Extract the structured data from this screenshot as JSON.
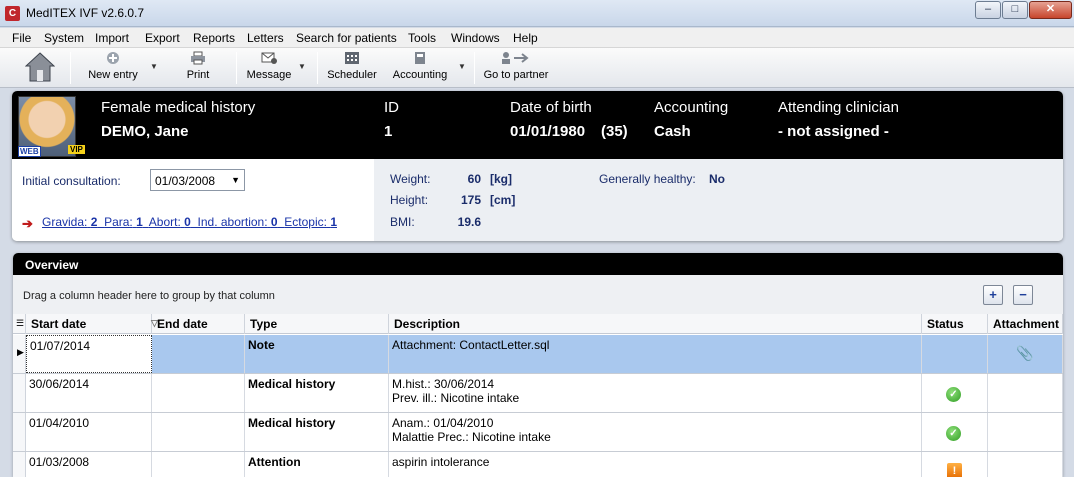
{
  "window": {
    "title": "MedITEX IVF v2.6.0.7",
    "icon": "C",
    "min": "‒",
    "max": "□",
    "close": "✕"
  },
  "menu": [
    "File",
    "System",
    "Import",
    "Export",
    "Reports",
    "Letters",
    "Search for patients",
    "Tools",
    "Windows",
    "Help"
  ],
  "toolbar": {
    "new_entry": "New entry",
    "print": "Print",
    "message": "Message",
    "scheduler": "Scheduler",
    "accounting": "Accounting",
    "go_to_partner": "Go to partner",
    "dropdown_glyph": "▼"
  },
  "patient": {
    "badge_web": "WEB",
    "badge_vip": "VIP",
    "history_label": "Female medical history",
    "name": "DEMO, Jane",
    "id_label": "ID",
    "id_value": "1",
    "dob_label": "Date of birth",
    "dob_value": "01/01/1980",
    "age": "(35)",
    "accounting_label": "Accounting",
    "accounting_value": "Cash",
    "clinician_label": "Attending clinician",
    "clinician_value": "- not assigned -",
    "initial_consultation_label": "Initial consultation:",
    "initial_consultation_value": "01/03/2008",
    "pregnancy": {
      "gravida_label": "Gravida:",
      "gravida": "2",
      "para_label": "Para:",
      "para": "1",
      "abort_label": "Abort:",
      "abort": "0",
      "ind_abortion_label": "Ind. abortion:",
      "ind_abortion": "0",
      "ectopic_label": "Ectopic:",
      "ectopic": "1"
    },
    "weight_label": "Weight:",
    "weight_value": "60",
    "weight_unit": "[kg]",
    "height_label": "Height:",
    "height_value": "175",
    "height_unit": "[cm]",
    "bmi_label": "BMI:",
    "bmi_value": "19.6",
    "healthy_label": "Generally healthy:",
    "healthy_value": "No"
  },
  "overview": {
    "title": "Overview",
    "group_hint": "Drag a column header here to group by that column",
    "expand_glyph": "+",
    "collapse_glyph": "−",
    "columns": [
      "Start date",
      "End date",
      "Type",
      "Description",
      "Status",
      "Attachment"
    ],
    "rows": [
      {
        "start": "01/07/2014",
        "end": "",
        "type": "Note",
        "desc1": "Attachment: ContactLetter.sql",
        "desc2": "",
        "status": "",
        "attachment": "paperclip-icon"
      },
      {
        "start": "30/06/2014",
        "end": "",
        "type": "Medical history",
        "desc1": "M.hist.: 30/06/2014",
        "desc2": "Prev. ill.: Nicotine intake",
        "status": "ok-icon",
        "attachment": ""
      },
      {
        "start": "01/04/2010",
        "end": "",
        "type": "Medical history",
        "desc1": "Anam.: 01/04/2010",
        "desc2": "Malattie Prec.: Nicotine intake",
        "status": "ok-icon",
        "attachment": ""
      },
      {
        "start": "01/03/2008",
        "end": "",
        "type": "Attention",
        "desc1": "aspirin intolerance",
        "desc2": "",
        "status": "warning-icon",
        "attachment": ""
      }
    ]
  }
}
